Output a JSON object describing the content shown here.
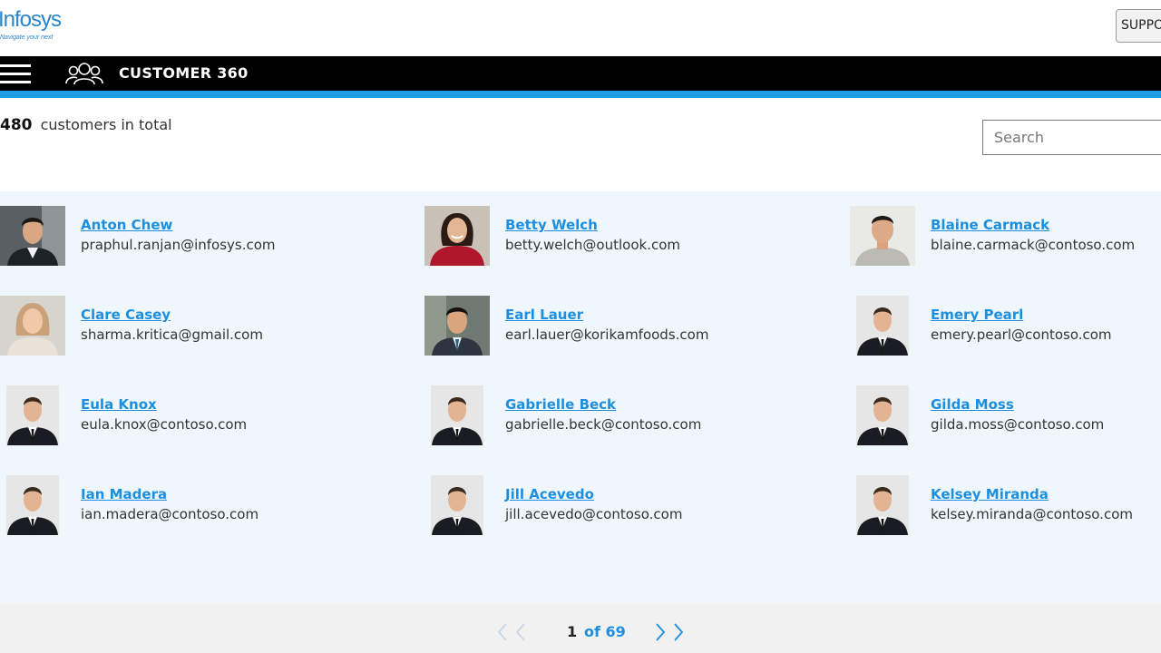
{
  "header": {
    "logo_text": "Infosys",
    "logo_tagline": "Navigate your next",
    "support_label": "SUPPORT"
  },
  "navbar": {
    "title": "CUSTOMER 360"
  },
  "summary": {
    "total_count": "480",
    "total_label": "customers in total"
  },
  "search": {
    "placeholder": "Search"
  },
  "customers": [
    {
      "name": "Anton Chew",
      "email": "praphul.ranjan@infosys.com"
    },
    {
      "name": "Betty Welch",
      "email": "betty.welch@outlook.com"
    },
    {
      "name": "Blaine Carmack",
      "email": "blaine.carmack@contoso.com"
    },
    {
      "name": "Clare Casey",
      "email": "sharma.kritica@gmail.com"
    },
    {
      "name": "Earl Lauer",
      "email": "earl.lauer@korikamfoods.com"
    },
    {
      "name": "Emery Pearl",
      "email": "emery.pearl@contoso.com"
    },
    {
      "name": "Eula Knox",
      "email": "eula.knox@contoso.com"
    },
    {
      "name": "Gabrielle Beck",
      "email": "gabrielle.beck@contoso.com"
    },
    {
      "name": "Gilda Moss",
      "email": "gilda.moss@contoso.com"
    },
    {
      "name": "Ian Madera",
      "email": "ian.madera@contoso.com"
    },
    {
      "name": "Jill Acevedo",
      "email": "jill.acevedo@contoso.com"
    },
    {
      "name": "Kelsey Miranda",
      "email": "kelsey.miranda@contoso.com"
    }
  ],
  "pagination": {
    "current_page": "1",
    "of_label": "of 69"
  },
  "colors": {
    "accent": "#1d9ce6",
    "link": "#1d8fe0",
    "navbar": "#000000",
    "grid_background": "#eff7fd"
  }
}
